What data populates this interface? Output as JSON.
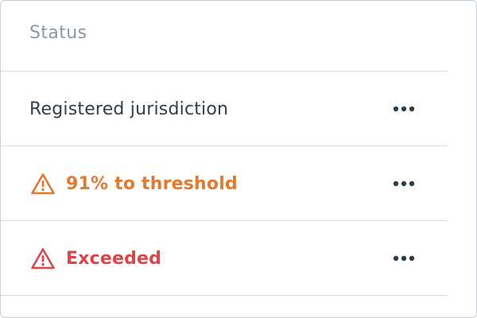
{
  "table": {
    "header": "Status",
    "rows": [
      {
        "label": "Registered jurisdiction",
        "status": "normal",
        "icon": "",
        "color": "#2f3e4a",
        "menu_icon": "more-horizontal-icon"
      },
      {
        "label": "91% to threshold",
        "status": "warning",
        "icon": "warning-triangle-icon",
        "color": "#e07a30",
        "menu_icon": "more-horizontal-icon"
      },
      {
        "label": "Exceeded",
        "status": "danger",
        "icon": "warning-triangle-icon",
        "color": "#d9464b",
        "menu_icon": "more-horizontal-icon"
      }
    ]
  },
  "colors": {
    "text": "#2f3e4a",
    "header": "#8c97a0",
    "warning": "#e07a30",
    "danger": "#d9464b",
    "divider": "#d9dee2"
  }
}
